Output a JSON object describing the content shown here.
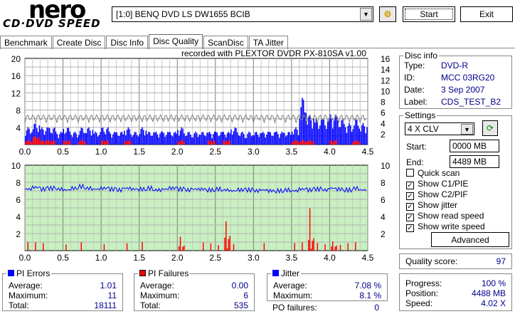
{
  "app": {
    "logo_top": "nero",
    "logo_bottom": "CD·DVD SPEED"
  },
  "toolbar": {
    "drive": "[1:0]  BENQ DVD LS DW1655 BCIB",
    "start": "Start",
    "exit": "Exit",
    "refresh_icon": "refresh-drive-icon"
  },
  "tabs": [
    "Benchmark",
    "Create Disc",
    "Disc Info",
    "Disc Quality",
    "ScanDisc",
    "TA Jitter"
  ],
  "active_tab": "Disc Quality",
  "recorded_with": "recorded with PLEXTOR DVDR   PX-810SA  v1.00",
  "disc_info": {
    "title": "Disc info",
    "rows": [
      {
        "k": "Type:",
        "v": "DVD-R"
      },
      {
        "k": "ID:",
        "v": "MCC 03RG20"
      },
      {
        "k": "Date:",
        "v": "3 Sep 2007"
      },
      {
        "k": "Label:",
        "v": "CDS_TEST_B2"
      }
    ]
  },
  "settings": {
    "title": "Settings",
    "speed": "4 X CLV",
    "start_label": "Start:",
    "start": "0000 MB",
    "end_label": "End:",
    "end": "4489 MB",
    "checks": [
      {
        "label": "Quick scan",
        "checked": false
      },
      {
        "label": "Show C1/PIE",
        "checked": true
      },
      {
        "label": "Show C2/PIF",
        "checked": true
      },
      {
        "label": "Show jitter",
        "checked": true
      },
      {
        "label": "Show read speed",
        "checked": true
      },
      {
        "label": "Show write speed",
        "checked": true
      }
    ],
    "advanced": "Advanced"
  },
  "quality": {
    "label": "Quality score:",
    "value": "97"
  },
  "progress": {
    "rows": [
      {
        "k": "Progress:",
        "v": "100 %"
      },
      {
        "k": "Position:",
        "v": "4488 MB"
      },
      {
        "k": "Speed:",
        "v": "4.02 X"
      }
    ]
  },
  "pi_errors": {
    "title": "PI Errors",
    "color": "#0000ff",
    "rows": [
      {
        "k": "Average:",
        "v": "1.01"
      },
      {
        "k": "Maximum:",
        "v": "11"
      },
      {
        "k": "Total:",
        "v": "18111"
      }
    ]
  },
  "pi_failures": {
    "title": "PI Failures",
    "color": "#ff0000",
    "rows": [
      {
        "k": "Average:",
        "v": "0.00"
      },
      {
        "k": "Maximum:",
        "v": "6"
      },
      {
        "k": "Total:",
        "v": "535"
      }
    ]
  },
  "jitter": {
    "title": "Jitter",
    "color": "#0000ff",
    "rows": [
      {
        "k": "Average:",
        "v": "7.08 %"
      },
      {
        "k": "Maximum:",
        "v": "8.1 %"
      }
    ]
  },
  "po_failures": {
    "label": "PO failures:",
    "value": "0"
  },
  "chart_data": [
    {
      "type": "bar",
      "xlim": [
        0,
        4.5
      ],
      "ylim_left": [
        0,
        20
      ],
      "ylim_right": [
        0,
        16
      ],
      "grid": true,
      "x_ticks": [
        "0.0",
        "0.5",
        "1.0",
        "1.5",
        "2.0",
        "2.5",
        "3.0",
        "3.5",
        "4.0",
        "4.5"
      ],
      "y_ticks_left": [
        "4",
        "8",
        "12",
        "16",
        "20"
      ],
      "y_ticks_right": [
        "2",
        "4",
        "6",
        "8",
        "10",
        "12",
        "14",
        "16"
      ],
      "x": [
        0.0,
        0.1,
        0.2,
        0.3,
        0.4,
        0.5,
        0.6,
        0.7,
        0.8,
        0.9,
        1.0,
        1.1,
        1.2,
        1.3,
        1.4,
        1.5,
        1.6,
        1.7,
        1.8,
        1.9,
        2.0,
        2.1,
        2.2,
        2.3,
        2.4,
        2.5,
        2.6,
        2.7,
        2.8,
        2.9,
        3.0,
        3.1,
        3.2,
        3.3,
        3.4,
        3.5,
        3.6,
        3.7,
        3.8,
        3.9,
        4.0,
        4.1,
        4.2,
        4.3,
        4.4
      ],
      "series": [
        {
          "name": "PI Errors",
          "color": "#0000ff",
          "values": [
            4,
            5,
            4,
            4,
            3,
            4,
            3,
            4,
            4,
            3,
            4,
            3,
            3,
            4,
            3,
            4,
            3,
            3,
            3,
            3,
            4,
            3,
            3,
            3,
            3,
            3,
            3,
            4,
            3,
            3,
            3,
            3,
            3,
            3,
            3,
            4,
            11,
            7,
            6,
            6,
            7,
            6,
            5,
            6,
            5
          ]
        },
        {
          "name": "PI Failures",
          "color": "#ff0000",
          "values": [
            1,
            2,
            1,
            1,
            0,
            1,
            0,
            1,
            0,
            0,
            1,
            0,
            0,
            1,
            0,
            0,
            0,
            0,
            0,
            0,
            1,
            0,
            0,
            0,
            1,
            0,
            1,
            0,
            0,
            0,
            0,
            0,
            0,
            0,
            0,
            1,
            1,
            1,
            0,
            0,
            1,
            0,
            0,
            1,
            0
          ]
        },
        {
          "name": "Read speed",
          "color": "#808080",
          "axis": "right",
          "values": [
            4,
            4,
            4,
            4,
            4,
            4,
            4,
            4,
            4,
            4,
            4,
            4,
            4,
            4,
            4,
            4,
            4,
            4,
            4,
            4,
            4,
            4,
            4,
            4,
            4,
            4,
            4,
            4,
            4,
            4,
            4,
            4,
            4,
            4,
            4,
            4,
            4,
            4,
            4,
            4,
            4,
            4,
            4,
            4,
            4
          ]
        }
      ]
    },
    {
      "type": "bar",
      "xlim": [
        0,
        4.5
      ],
      "ylim_left": [
        0,
        10
      ],
      "ylim_right": [
        0,
        10
      ],
      "grid": true,
      "background": "#c8f0c0",
      "x_ticks": [
        "0.0",
        "0.5",
        "1.0",
        "1.5",
        "2.0",
        "2.5",
        "3.0",
        "3.5",
        "4.0",
        "4.5"
      ],
      "y_ticks_left": [
        "2",
        "4",
        "6",
        "8",
        "10"
      ],
      "y_ticks_right": [
        "2",
        "4",
        "6",
        "8",
        "10"
      ],
      "x": [
        0.0,
        0.1,
        0.2,
        0.3,
        0.4,
        0.5,
        0.6,
        0.7,
        0.8,
        0.9,
        1.0,
        1.1,
        1.2,
        1.3,
        1.4,
        1.5,
        1.6,
        1.7,
        1.8,
        1.9,
        2.0,
        2.1,
        2.2,
        2.3,
        2.4,
        2.5,
        2.6,
        2.7,
        2.8,
        2.9,
        3.0,
        3.1,
        3.2,
        3.3,
        3.4,
        3.5,
        3.6,
        3.7,
        3.8,
        3.9,
        4.0,
        4.1,
        4.2,
        4.3,
        4.4
      ],
      "series": [
        {
          "name": "PI Failures",
          "color": "#ff0000",
          "values": [
            1,
            1,
            1,
            0,
            0,
            1,
            0,
            1,
            0,
            0,
            1,
            0,
            0,
            1,
            0,
            1,
            0,
            0,
            0,
            0,
            2,
            0,
            0,
            1,
            1,
            1,
            6,
            1,
            0,
            0,
            0,
            1,
            0,
            0,
            0,
            1,
            1,
            5,
            1,
            1,
            2,
            1,
            1,
            1,
            0
          ]
        },
        {
          "name": "Jitter",
          "color": "#0000ff",
          "values": [
            7.2,
            7.4,
            7.2,
            7.3,
            7.2,
            7.1,
            7.3,
            7.5,
            7.3,
            7.2,
            7.3,
            7.2,
            7.1,
            7.3,
            7.2,
            7.2,
            7.3,
            7.1,
            7.2,
            7.3,
            7.2,
            7.1,
            7.2,
            7.2,
            7.1,
            7.2,
            7.1,
            7.0,
            7.1,
            7.1,
            7.0,
            7.1,
            7.0,
            7.0,
            7.1,
            7.0,
            7.2,
            7.1,
            7.2,
            7.1,
            7.3,
            7.2,
            7.1,
            7.3,
            7.1
          ]
        }
      ]
    }
  ]
}
